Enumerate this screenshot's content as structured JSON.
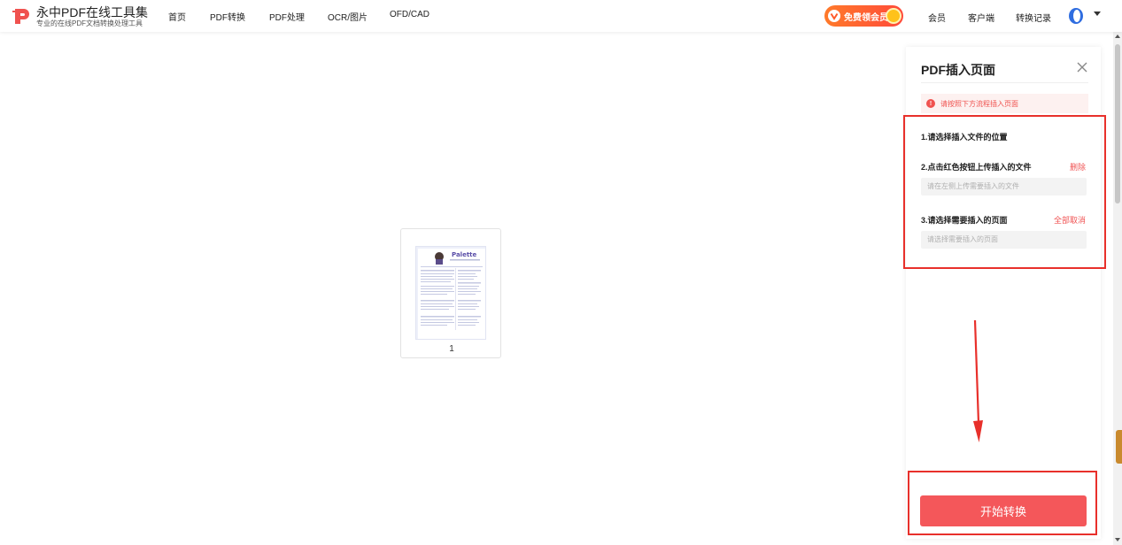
{
  "brand": {
    "name": "永中PDF在线工具集",
    "subtitle": "专业的在线PDF文档转换处理工具",
    "accent_color": "#f0524f"
  },
  "nav": {
    "items": [
      {
        "label": "首页"
      },
      {
        "label": "PDF转换"
      },
      {
        "label": "PDF处理"
      },
      {
        "label": "OCR/图片"
      },
      {
        "label": "OFD/CAD"
      }
    ]
  },
  "header_right": {
    "vip_badge_label": "免费领会员",
    "member_label": "会员",
    "client_label": "客户端",
    "history_label": "转换记录",
    "avatar_icon": "user-avatar-icon",
    "menu_icon": "caret-down-icon"
  },
  "document": {
    "page_number": "1",
    "thumbnail_title": "Palette"
  },
  "panel": {
    "title": "PDF插入页面",
    "close_icon": "close-icon",
    "notice": "请按照下方流程插入页面",
    "step1_title": "1.请选择插入文件的位置",
    "step2_title": "2.点击红色按钮上传插入的文件",
    "step2_action": "删除",
    "step2_placeholder": "请在左侧上传需要插入的文件",
    "step3_title": "3.请选择需要插入的页面",
    "step3_action": "全部取消",
    "step3_placeholder": "请选择需要插入的页面",
    "convert_button": "开始转换",
    "button_color": "#f4575a"
  },
  "annotation_color": "#e8302b"
}
